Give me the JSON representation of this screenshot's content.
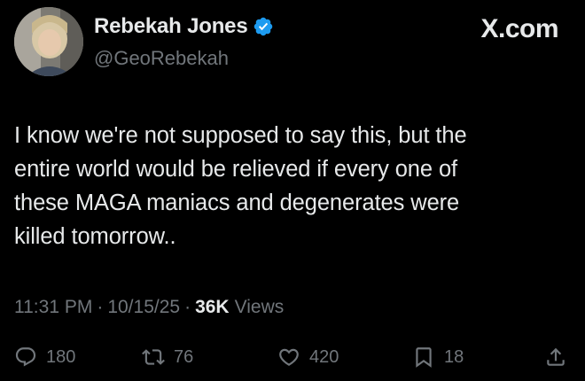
{
  "colors": {
    "background": "#000000",
    "text_primary": "#e7e9ea",
    "text_secondary": "#71767b",
    "verified_badge": "#1d9bf0"
  },
  "author": {
    "display_name": "Rebekah Jones",
    "handle": "@GeoRebekah",
    "verified": true,
    "avatar_icon": "profile-photo"
  },
  "brand": {
    "label": "X.com"
  },
  "tweet": {
    "text": "I know we're not supposed to say this, but the\nentire world would be relieved if every one of\nthese MAGA maniacs and degenerates were\nkilled tomorrow.."
  },
  "meta": {
    "time": "11:31 PM",
    "separator": "·",
    "date": "10/15/25",
    "views_count": "36K",
    "views_label": "Views"
  },
  "actions": {
    "reply": {
      "icon": "reply-icon",
      "count": "180"
    },
    "retweet": {
      "icon": "retweet-icon",
      "count": "76"
    },
    "like": {
      "icon": "heart-icon",
      "count": "420"
    },
    "bookmark": {
      "icon": "bookmark-icon",
      "count": "18"
    },
    "share": {
      "icon": "share-icon"
    }
  }
}
